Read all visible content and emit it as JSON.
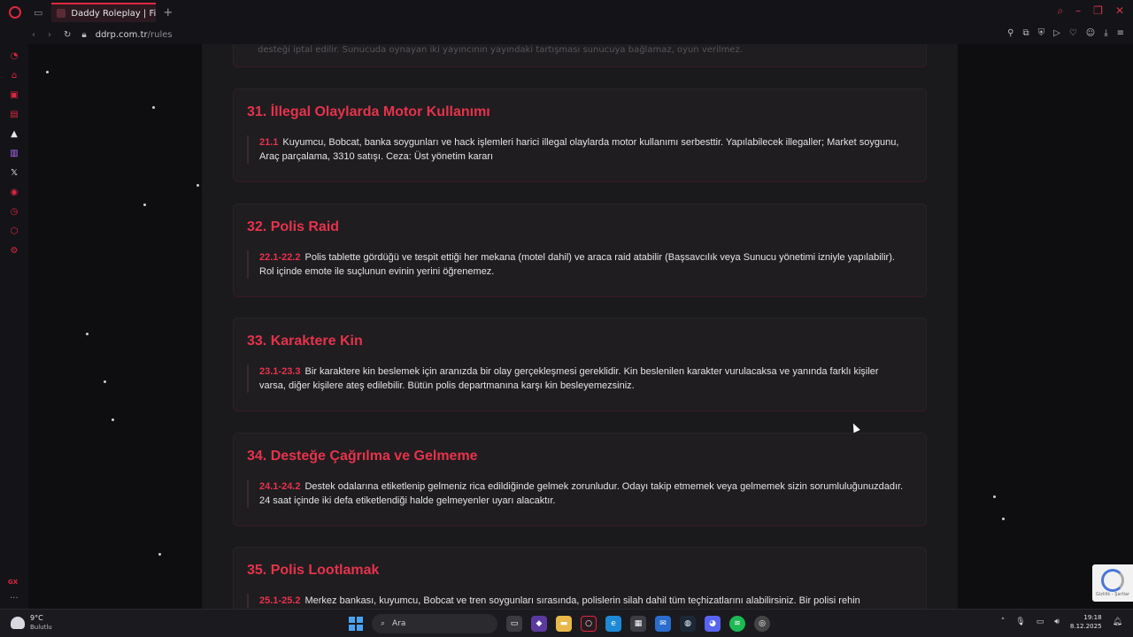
{
  "browser": {
    "tab_title": "Daddy Roleplay | Fivem R",
    "url_host": "ddrp.com.tr",
    "url_path": "/rules"
  },
  "page": {
    "partial_text": "desteği iptal edilir. Sunucuda oynayan iki yayıncının yayındaki tartışması sunucuya bağlamaz, oyun verilmez.",
    "rules": [
      {
        "title": "31. İllegal Olaylarda Motor Kullanımı",
        "code": "21.1",
        "text": "Kuyumcu, Bobcat, banka soygunları ve hack işlemleri harici illegal olaylarda motor kullanımı serbesttir. Yapılabilecek illegaller; Market soygunu, Araç parçalama, 3310 satışı. Ceza: Üst yönetim kararı"
      },
      {
        "title": "32. Polis Raid",
        "code": "22.1-22.2",
        "text": "Polis tablette gördüğü ve tespit ettiği her mekana (motel dahil) ve araca raid atabilir (Başsavcılık veya Sunucu yönetimi izniyle yapılabilir). Rol içinde emote ile suçlunun evinin yerini öğrenemez."
      },
      {
        "title": "33. Karaktere Kin",
        "code": "23.1-23.3",
        "text": "Bir karaktere kin beslemek için aranızda bir olay gerçekleşmesi gereklidir. Kin beslenilen karakter vurulacaksa ve yanında farklı kişiler varsa, diğer kişilere ateş edilebilir. Bütün polis departmanına karşı kin besleyemezsiniz."
      },
      {
        "title": "34. Desteğe Çağrılma ve Gelmeme",
        "code": "24.1-24.2",
        "text": "Destek odalarına etiketlenip gelmeniz rica edildiğinde gelmek zorunludur. Odayı takip etmemek veya gelmemek sizin sorumluluğunuzdadır. 24 saat içinde iki defa etiketlendiği halde gelmeyenler uyarı alacaktır."
      },
      {
        "title": "35. Polis Lootlamak",
        "code": "25.1-25.2",
        "text": "Merkez bankası, kuyumcu, Bobcat ve tren soygunları sırasında, polislerin silah dahil tüm teçhizatlarını alabilirsiniz. Bir polisi rehin"
      }
    ]
  },
  "recaptcha": {
    "label": "Gizlilik - Şartlar"
  },
  "taskbar": {
    "weather_temp": "9°C",
    "weather_desc": "Bulutlu",
    "search_placeholder": "Ara",
    "time": "19:18",
    "date": "8.12.2025"
  },
  "colors": {
    "accent": "#e5334c",
    "background": "#0e0e10",
    "card": "#1f1d20"
  }
}
